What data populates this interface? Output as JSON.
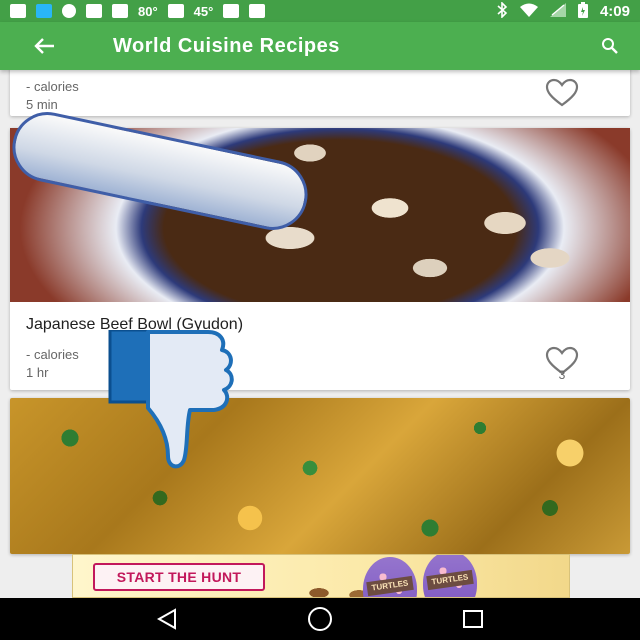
{
  "status_bar": {
    "temp1": "80°",
    "temp2": "45°",
    "time": "4:09",
    "icons": [
      "message-icon",
      "dictionary-icon",
      "info-icon",
      "no-wifi-icon",
      "lock-icon",
      "weather-icon",
      "android-icon",
      "photo-icon",
      "briefcase-icon",
      "bluetooth-icon",
      "wifi-icon",
      "signal-icon",
      "battery-icon"
    ]
  },
  "app_bar": {
    "title": "World Cuisine Recipes",
    "back_icon": "arrow-back-icon",
    "search_icon": "search-icon",
    "color": "#4caf50"
  },
  "recipes": [
    {
      "title": "",
      "calories": "- calories",
      "time": "5 min",
      "likes": ""
    },
    {
      "title": "Japanese Beef Bowl (Gyudon)",
      "calories": "- calories",
      "time": "1 hr",
      "likes": "3"
    },
    {
      "title": "",
      "calories": "",
      "time": "",
      "likes": ""
    }
  ],
  "overlay": {
    "icon": "thumbs-down-icon"
  },
  "ad": {
    "cta": "START THE HUNT",
    "brand": "TURTLES"
  },
  "nav_bar": {
    "icons": [
      "back-nav-icon",
      "home-nav-icon",
      "recents-nav-icon"
    ]
  }
}
